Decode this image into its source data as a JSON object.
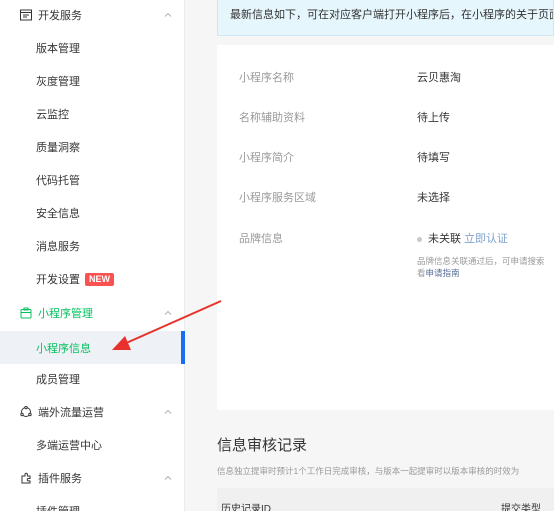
{
  "sidebar": {
    "dev_services": {
      "label": "开发服务",
      "items": [
        "版本管理",
        "灰度管理",
        "云监控",
        "质量洞察",
        "代码托管",
        "安全信息",
        "消息服务",
        "开发设置"
      ],
      "new_badge": "NEW"
    },
    "miniprogram_mgmt": {
      "label": "小程序管理",
      "items": [
        "小程序信息",
        "成员管理"
      ]
    },
    "external_ops": {
      "label": "端外流量运营",
      "items": [
        "多端运营中心"
      ]
    },
    "plugin_services": {
      "label": "插件服务",
      "items": [
        "插件管理"
      ]
    },
    "active_color": "#07c160"
  },
  "notice": {
    "text": "最新信息如下，可在对应客户端打开小程序后，在小程序的关于页面"
  },
  "info": {
    "rows": [
      {
        "key": "小程序名称",
        "value": "云贝惠淘"
      },
      {
        "key": "名称辅助资料",
        "value": "待上传"
      },
      {
        "key": "小程序简介",
        "value": "待填写"
      },
      {
        "key": "小程序服务区域",
        "value": "未选择"
      },
      {
        "key": "品牌信息",
        "value": "未关联",
        "action": "立即认证"
      }
    ],
    "brand_note": "品牌信息关联通过后，可申请搜索",
    "brand_note_tail": "看",
    "brand_guide_link": "申请指南"
  },
  "audit": {
    "title": "信息审核记录",
    "desc": "信息独立提审时预计1个工作日完成审核，与版本一起提审时以版本审核的时效为",
    "col_history_id": "历史记录ID",
    "col_submit_type": "提交类型"
  }
}
